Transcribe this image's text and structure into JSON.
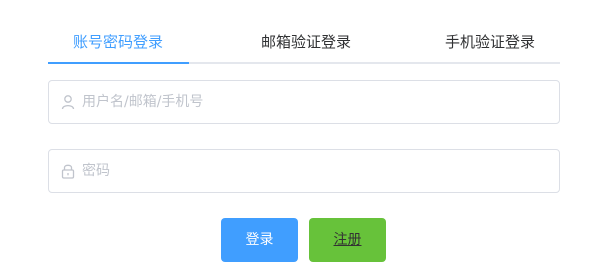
{
  "tabs": [
    {
      "label": "账号密码登录",
      "active": true
    },
    {
      "label": "邮箱验证登录",
      "active": false
    },
    {
      "label": "手机验证登录",
      "active": false
    }
  ],
  "form": {
    "username": {
      "placeholder": "用户名/邮箱/手机号",
      "value": "",
      "icon": "user-icon"
    },
    "password": {
      "placeholder": "密码",
      "value": "",
      "icon": "lock-icon"
    }
  },
  "buttons": {
    "login": "登录",
    "register": "注册"
  },
  "colors": {
    "accent": "#409eff",
    "success": "#67c23a",
    "border": "#dcdfe6",
    "placeholder": "#c0c4cc"
  }
}
